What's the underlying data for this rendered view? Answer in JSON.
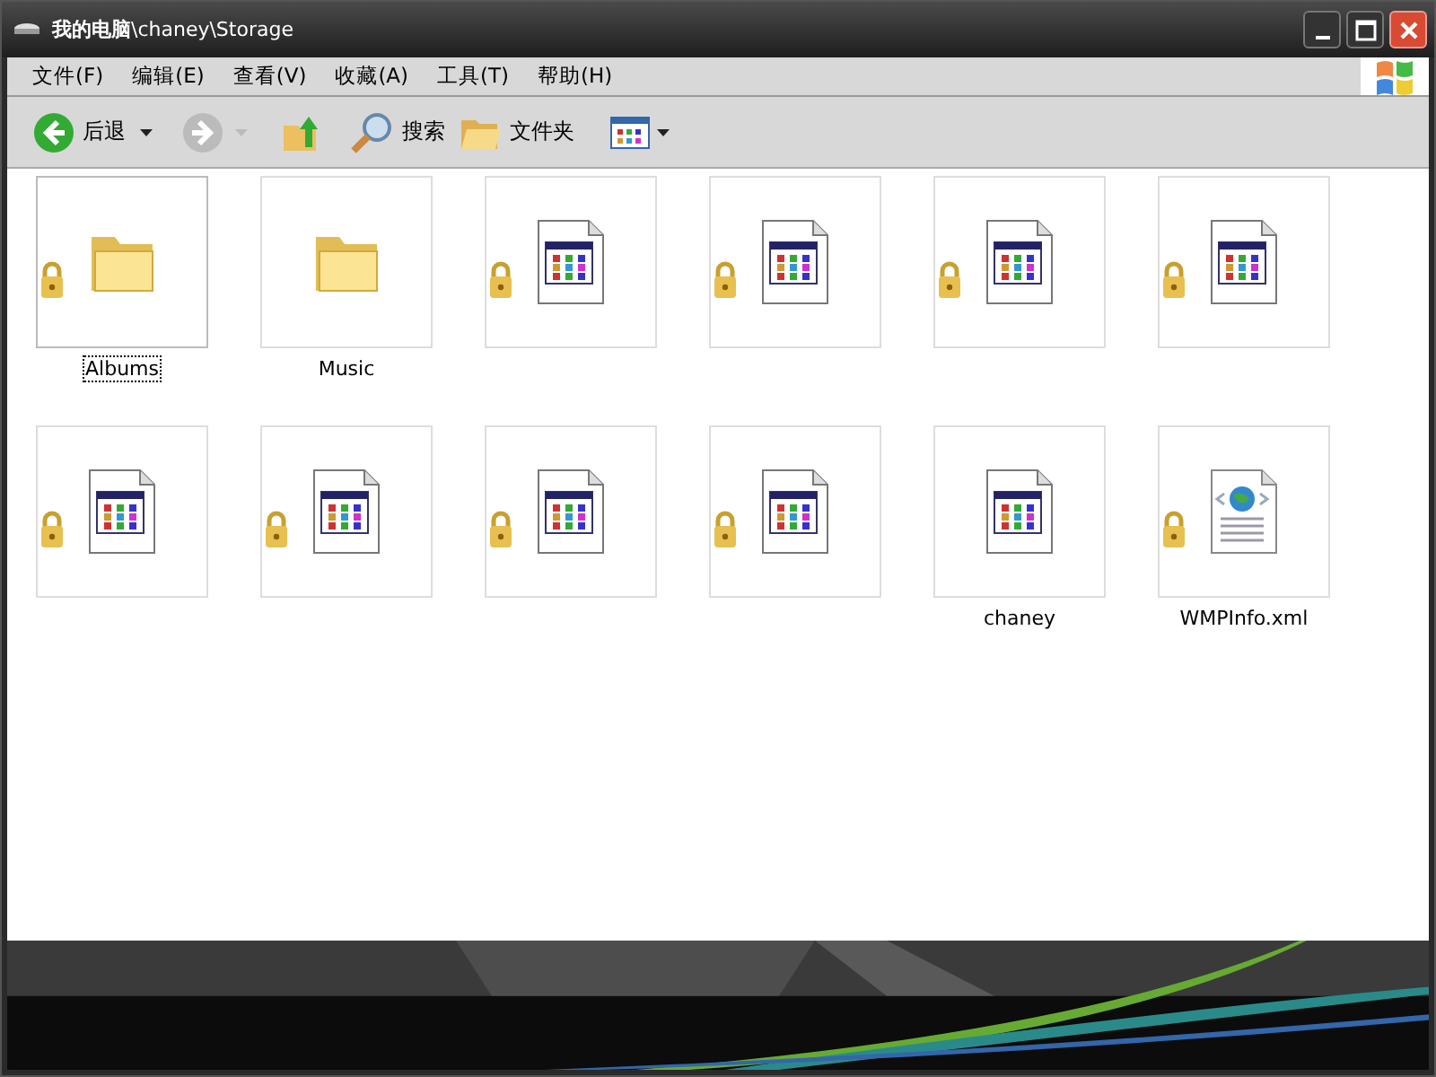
{
  "window": {
    "title": "**我的电脑**\\chaney\\Storage"
  },
  "menu": [
    "文件(F)",
    "编辑(E)",
    "查看(V)",
    "收藏(A)",
    "工具(T)",
    "帮助(H)"
  ],
  "toolbar": {
    "back": "后退",
    "search": "搜索",
    "folders": "文件夹"
  },
  "items": [
    {
      "kind": "folder",
      "label": "Albums",
      "locked": true,
      "selected": true
    },
    {
      "kind": "folder",
      "label": "Music",
      "locked": false,
      "selected": false
    },
    {
      "kind": "app",
      "locked": true,
      "selected": false
    },
    {
      "kind": "app",
      "locked": true,
      "selected": false
    },
    {
      "kind": "app",
      "locked": true,
      "selected": false
    },
    {
      "kind": "app",
      "locked": true,
      "selected": false
    },
    {
      "kind": "app",
      "locked": true,
      "selected": false
    },
    {
      "kind": "app",
      "locked": true,
      "selected": false
    },
    {
      "kind": "app",
      "locked": true,
      "selected": false
    },
    {
      "kind": "app",
      "locked": true,
      "selected": false
    },
    {
      "kind": "app",
      "label": "chaney",
      "locked": false,
      "selected": false
    },
    {
      "kind": "xml",
      "label": "WMPInfo.xml",
      "locked": true,
      "selected": false
    }
  ]
}
